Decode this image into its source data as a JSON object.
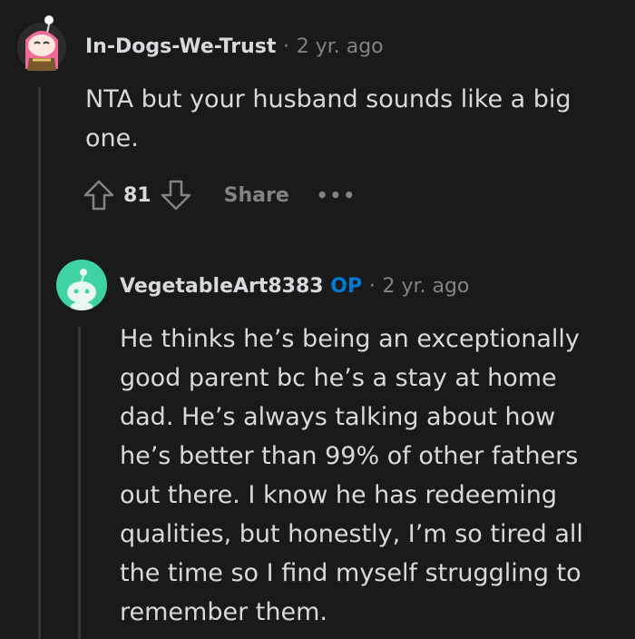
{
  "comment": {
    "username": "In-Dogs-We-Trust",
    "separator": "·",
    "time": "2 yr. ago",
    "text": "NTA but your husband sounds like a big one.",
    "votes": "81",
    "share_label": "Share",
    "more_label": "•••"
  },
  "reply": {
    "username": "VegetableArt8383",
    "op_badge": "OP",
    "separator": "·",
    "time": "2 yr. ago",
    "text": "He thinks he’s being an exceptionally good parent bc he’s a stay at home dad. He’s always talking about how he’s better than 99% of other fathers out there. I know he has redeeming qualities, but honestly, I’m so tired all the time so I find myself struggling to remember them."
  },
  "colors": {
    "background": "#1a1a1b",
    "text": "#d7dadc",
    "muted": "#818384",
    "op": "#0079d3",
    "reply_avatar_bg": "#3fd2a4"
  }
}
